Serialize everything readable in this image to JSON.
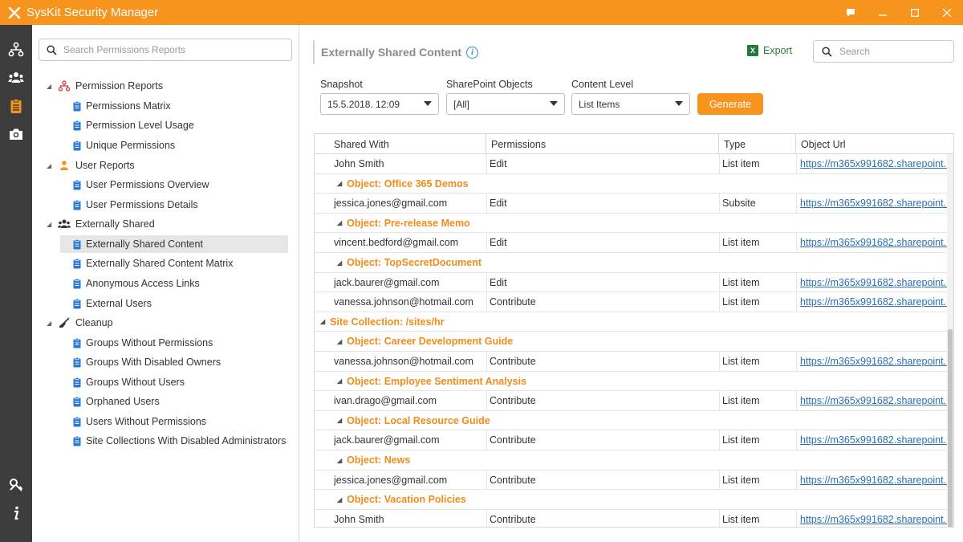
{
  "app": {
    "title": "SysKit Security Manager"
  },
  "window": {
    "buttons": [
      "feedback-icon",
      "minimize-icon",
      "maximize-icon",
      "close-icon"
    ]
  },
  "rail": {
    "top_icons": [
      "org-chart-icon",
      "users-icon",
      "clipboard-icon",
      "camera-icon"
    ],
    "bottom_icons": [
      "keys-icon",
      "info-icon"
    ]
  },
  "tree": {
    "search_placeholder": "Search Permissions Reports",
    "groups": [
      {
        "label": "Permission Reports",
        "icon": "org-chart-icon",
        "items": [
          "Permissions Matrix",
          "Permission Level Usage",
          "Unique Permissions"
        ]
      },
      {
        "label": "User Reports",
        "icon": "user-icon",
        "items": [
          "User Permissions Overview",
          "User Permissions Details"
        ]
      },
      {
        "label": "Externally Shared",
        "icon": "users-icon",
        "items": [
          "Externally Shared Content",
          "Externally Shared Content Matrix",
          "Anonymous Access Links",
          "External Users"
        ]
      },
      {
        "label": "Cleanup",
        "icon": "broom-icon",
        "items": [
          "Groups Without Permissions",
          "Groups With Disabled Owners",
          "Groups Without Users",
          "Orphaned Users",
          "Users Without Permissions",
          "Site Collections With Disabled Administrators"
        ]
      }
    ],
    "selected": "Externally Shared Content"
  },
  "main": {
    "title": "Externally Shared Content",
    "export_label": "Export",
    "search_placeholder": "Search",
    "filters": {
      "snapshot_label": "Snapshot",
      "snapshot_value": "15.5.2018. 12:09",
      "objects_label": "SharePoint Objects",
      "objects_value": "[All]",
      "level_label": "Content Level",
      "level_value": "List Items"
    },
    "generate_label": "Generate",
    "columns": [
      "Shared With",
      "Permissions",
      "Type",
      "Object Url"
    ],
    "url_text": "https://m365x991682.sharepoint...",
    "rows": [
      {
        "kind": "data",
        "shared_with": "John Smith",
        "permissions": "Edit",
        "type": "List item",
        "url": "https://m365x991682.sharepoint..."
      },
      {
        "kind": "object",
        "label": "Object: Office 365 Demos"
      },
      {
        "kind": "data",
        "shared_with": "jessica.jones@gmail.com",
        "permissions": "Edit",
        "type": "Subsite",
        "url": "https://m365x991682.sharepoint..."
      },
      {
        "kind": "object",
        "label": "Object: Pre-release Memo"
      },
      {
        "kind": "data",
        "shared_with": "vincent.bedford@gmail.com",
        "permissions": "Edit",
        "type": "List item",
        "url": "https://m365x991682.sharepoint..."
      },
      {
        "kind": "object",
        "label": "Object: TopSecretDocument"
      },
      {
        "kind": "data",
        "shared_with": "jack.baurer@gmail.com",
        "permissions": "Edit",
        "type": "List item",
        "url": "https://m365x991682.sharepoint..."
      },
      {
        "kind": "data",
        "shared_with": "vanessa.johnson@hotmail.com",
        "permissions": "Contribute",
        "type": "List item",
        "url": "https://m365x991682.sharepoint..."
      },
      {
        "kind": "site",
        "label": "Site Collection: /sites/hr"
      },
      {
        "kind": "object",
        "label": "Object: Career Development Guide"
      },
      {
        "kind": "data",
        "shared_with": "vanessa.johnson@hotmail.com",
        "permissions": "Contribute",
        "type": "List item",
        "url": "https://m365x991682.sharepoint..."
      },
      {
        "kind": "object",
        "label": "Object: Employee Sentiment Analysis"
      },
      {
        "kind": "data",
        "shared_with": "ivan.drago@gmail.com",
        "permissions": "Contribute",
        "type": "List item",
        "url": "https://m365x991682.sharepoint..."
      },
      {
        "kind": "object",
        "label": "Object: Local Resource Guide"
      },
      {
        "kind": "data",
        "shared_with": "jack.baurer@gmail.com",
        "permissions": "Contribute",
        "type": "List item",
        "url": "https://m365x991682.sharepoint..."
      },
      {
        "kind": "object",
        "label": "Object: News"
      },
      {
        "kind": "data",
        "shared_with": "jessica.jones@gmail.com",
        "permissions": "Contribute",
        "type": "List item",
        "url": "https://m365x991682.sharepoint..."
      },
      {
        "kind": "object",
        "label": "Object: Vacation Policies"
      },
      {
        "kind": "data",
        "shared_with": "John Smith",
        "permissions": "Contribute",
        "type": "List item",
        "url": "https://m365x991682.sharepoint..."
      }
    ]
  },
  "colors": {
    "accent": "#f7941d",
    "rail": "#3c3c3c",
    "link": "#2a6fb5",
    "group_text": "#f08c1a"
  }
}
